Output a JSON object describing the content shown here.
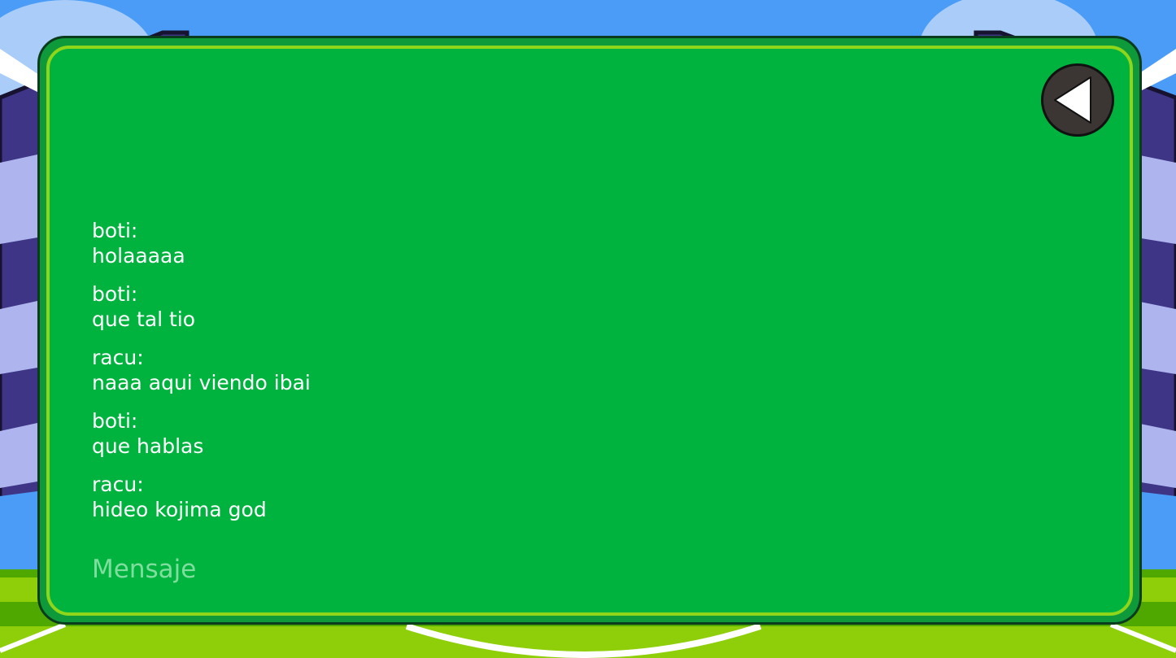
{
  "chat": {
    "messages": [
      {
        "author": "boti:",
        "text": "holaaaaa"
      },
      {
        "author": "boti:",
        "text": "que tal tio"
      },
      {
        "author": "racu:",
        "text": "naaa aqui viendo ibai"
      },
      {
        "author": "boti:",
        "text": "que hablas"
      },
      {
        "author": "racu:",
        "text": "hideo kojima god"
      }
    ]
  },
  "input": {
    "value": "",
    "placeholder": "Mensaje"
  },
  "back_button": {
    "icon": "triangle-left-icon"
  },
  "colors": {
    "sky": "#4a9cf6",
    "panel_border": "#8fd61a",
    "panel_fill": "#00b33e",
    "pitch": "#4fa800",
    "button_fill": "#3b3634"
  }
}
